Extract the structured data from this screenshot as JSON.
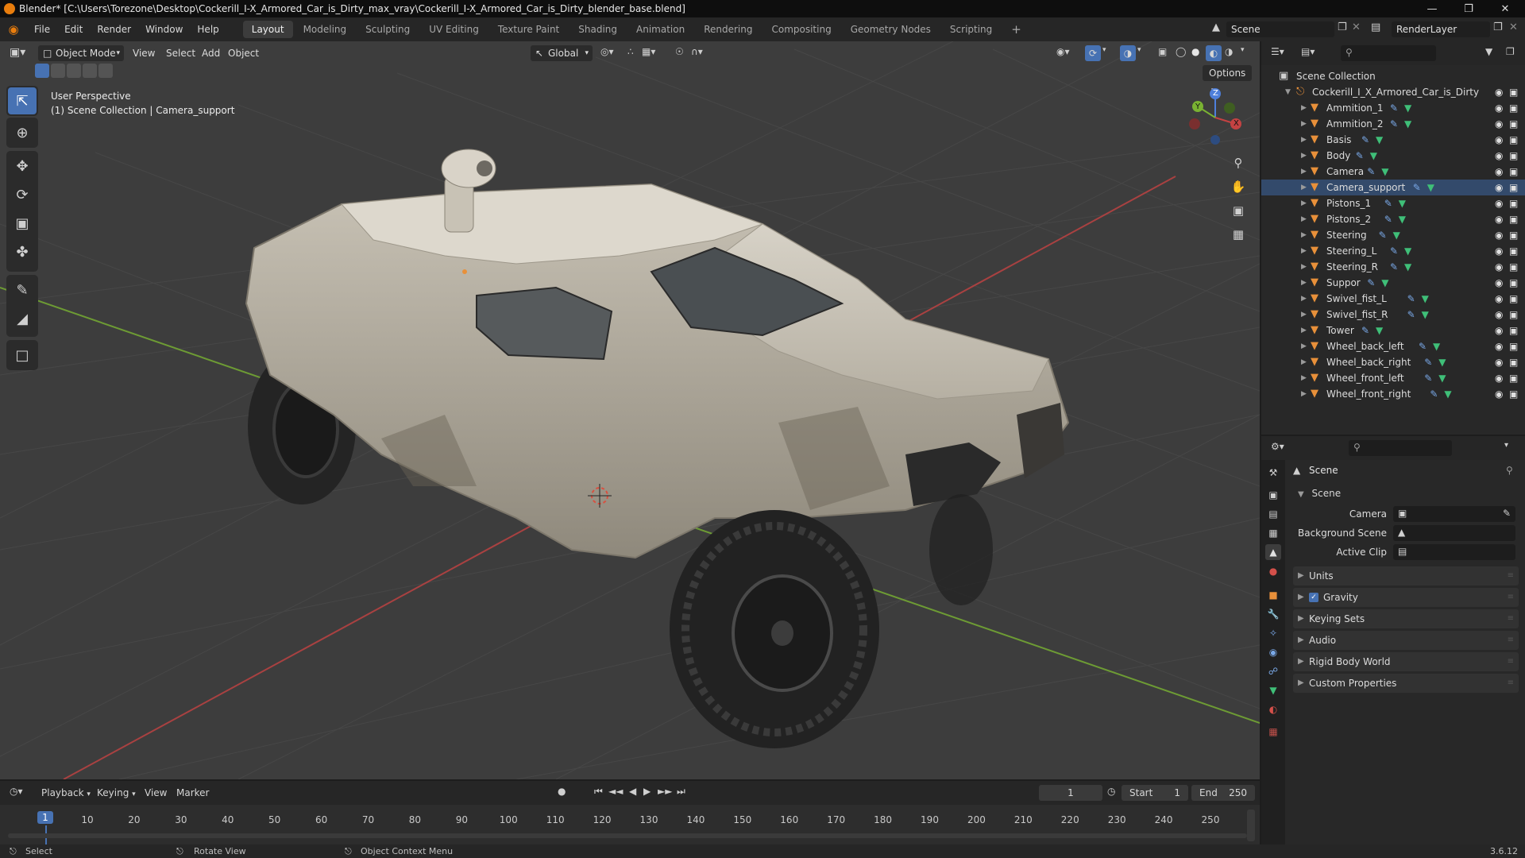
{
  "window": {
    "title": "Blender* [C:\\Users\\Torezone\\Desktop\\Cockerill_I-X_Armored_Car_is_Dirty_max_vray\\Cockerill_I-X_Armored_Car_is_Dirty_blender_base.blend]"
  },
  "menubar": {
    "menus": [
      "File",
      "Edit",
      "Render",
      "Window",
      "Help"
    ],
    "workspaces": [
      "Layout",
      "Modeling",
      "Sculpting",
      "UV Editing",
      "Texture Paint",
      "Shading",
      "Animation",
      "Rendering",
      "Compositing",
      "Geometry Nodes",
      "Scripting"
    ],
    "active_workspace": "Layout",
    "add_tab": "+",
    "scene": "Scene",
    "render_layer": "RenderLayer"
  },
  "viewport": {
    "mode": "Object Mode",
    "menus": [
      "View",
      "Select",
      "Add",
      "Object"
    ],
    "transform": "Global",
    "options_label": "Options",
    "overlay_line1": "User Perspective",
    "overlay_line2": "(1) Scene Collection | Camera_support",
    "gizmo": {
      "z": "Z",
      "y": "Y",
      "x": "X"
    }
  },
  "outliner": {
    "root": "Scene Collection",
    "collection": "Cockerill_I_X_Armored_Car_is_Dirty",
    "objects": [
      "Ammition_1",
      "Ammition_2",
      "Basis",
      "Body",
      "Camera",
      "Camera_support",
      "Pistons_1",
      "Pistons_2",
      "Steering",
      "Steering_L",
      "Steering_R",
      "Suppor",
      "Swivel_fist_L",
      "Swivel_fist_R",
      "Tower",
      "Wheel_back_left",
      "Wheel_back_right",
      "Wheel_front_left",
      "Wheel_front_right"
    ]
  },
  "properties": {
    "header": "Scene",
    "section": "Scene",
    "camera_label": "Camera",
    "background_scene_label": "Background Scene",
    "active_clip_label": "Active Clip",
    "panels": [
      "Units",
      "Gravity",
      "Keying Sets",
      "Audio",
      "Rigid Body World",
      "Custom Properties"
    ],
    "gravity_checked": true
  },
  "timeline": {
    "menus": [
      "Playback",
      "Keying",
      "View",
      "Marker"
    ],
    "current_frame": "1",
    "start_label": "Start",
    "start": "1",
    "end_label": "End",
    "end": "250",
    "ruler": [
      "1",
      "10",
      "20",
      "30",
      "40",
      "50",
      "60",
      "70",
      "80",
      "90",
      "100",
      "110",
      "120",
      "130",
      "140",
      "150",
      "160",
      "170",
      "180",
      "190",
      "200",
      "210",
      "220",
      "230",
      "240",
      "250"
    ]
  },
  "statusbar": {
    "left": "Select",
    "middle": "Rotate View",
    "right": "Object Context Menu",
    "version": "3.6.12"
  },
  "colors": {
    "accent": "#4772b3",
    "object_icon": "#e8903a",
    "mesh_icon": "#3fbf78",
    "modifier_icon": "#7aa9e8",
    "x_axis": "#c44242",
    "y_axis": "#7ab332"
  }
}
